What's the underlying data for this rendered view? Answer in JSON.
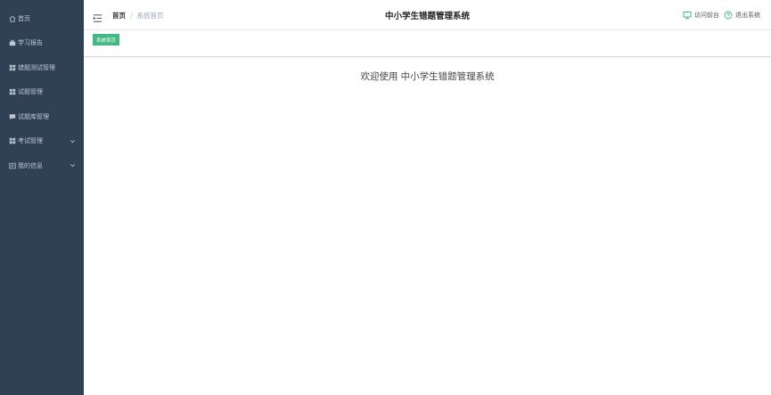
{
  "sidebar": {
    "items": [
      {
        "label": "首页",
        "icon": "home-icon",
        "has_submenu": false
      },
      {
        "label": "学习报告",
        "icon": "bag-icon",
        "has_submenu": false
      },
      {
        "label": "错题测试管理",
        "icon": "grid-icon",
        "has_submenu": false
      },
      {
        "label": "试题管理",
        "icon": "grid-icon",
        "has_submenu": false
      },
      {
        "label": "试题库管理",
        "icon": "comment-icon",
        "has_submenu": false
      },
      {
        "label": "考试管理",
        "icon": "grid-icon",
        "has_submenu": true
      },
      {
        "label": "我的信息",
        "icon": "card-icon",
        "has_submenu": true
      }
    ],
    "background_color": "#304156",
    "text_color": "#c0c8d4"
  },
  "navbar": {
    "breadcrumb_home": "首页",
    "breadcrumb_current": "系统首页",
    "title": "中小学生错题管理系统",
    "visit_frontend": "访问前台",
    "logout": "退出系统"
  },
  "tags": {
    "active_tag": "系统首页",
    "active_color": "#42b983"
  },
  "main": {
    "welcome": "欢迎使用 中小学生错题管理系统"
  }
}
